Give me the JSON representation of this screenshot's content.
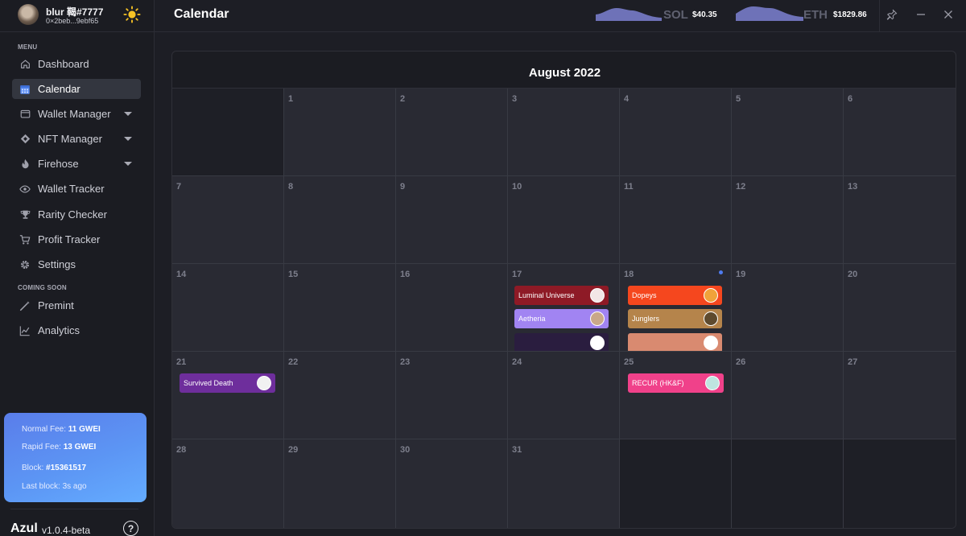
{
  "profile": {
    "username": "blur 鞨#7777",
    "address": "0×2beb...9ebf65"
  },
  "sidebar": {
    "menu_label": "MENU",
    "items": [
      {
        "label": "Dashboard",
        "icon": "home-icon"
      },
      {
        "label": "Calendar",
        "icon": "calendar-icon",
        "active": true
      },
      {
        "label": "Wallet Manager",
        "icon": "wallet-icon",
        "expandable": true
      },
      {
        "label": "NFT Manager",
        "icon": "diamond-icon",
        "expandable": true
      },
      {
        "label": "Firehose",
        "icon": "flame-icon",
        "expandable": true
      },
      {
        "label": "Wallet Tracker",
        "icon": "eye-icon"
      },
      {
        "label": "Rarity Checker",
        "icon": "trophy-icon"
      },
      {
        "label": "Profit Tracker",
        "icon": "cart-icon"
      },
      {
        "label": "Settings",
        "icon": "gear-icon"
      }
    ],
    "coming_soon_label": "COMING SOON",
    "coming_soon": [
      {
        "label": "Premint",
        "icon": "wand-icon"
      },
      {
        "label": "Analytics",
        "icon": "chart-icon"
      }
    ]
  },
  "fees": {
    "normal_label": "Normal Fee:",
    "normal_value": "11 GWEI",
    "rapid_label": "Rapid Fee:",
    "rapid_value": "13 GWEI",
    "block_label": "Block:",
    "block_value": "#15361517",
    "last_block_label": "Last block:",
    "last_block_value": "3s ago"
  },
  "brand": {
    "name": "Azul",
    "version": "v1.0.4-beta",
    "help": "?"
  },
  "topbar": {
    "title": "Calendar",
    "tickers": [
      {
        "symbol": "SOL",
        "price": "$40.35"
      },
      {
        "symbol": "ETH",
        "price": "$1829.86"
      }
    ]
  },
  "calendar": {
    "month": "August 2022",
    "weeks": [
      [
        "",
        "1",
        "2",
        "3",
        "4",
        "5",
        "6"
      ],
      [
        "7",
        "8",
        "9",
        "10",
        "11",
        "12",
        "13"
      ],
      [
        "14",
        "15",
        "16",
        "17",
        "18",
        "19",
        "20"
      ],
      [
        "21",
        "22",
        "23",
        "24",
        "25",
        "26",
        "27"
      ],
      [
        "28",
        "29",
        "30",
        "31",
        "",
        "",
        ""
      ]
    ],
    "events": [
      {
        "name": "Luminal Universe",
        "color": "#8e1a26",
        "logo_bg": "#f2e6e6"
      },
      {
        "name": "Aetheria",
        "color": "#a184f2",
        "logo_bg": "#c9a88a"
      },
      {
        "name": "",
        "color": "#2a1d3f",
        "logo_bg": "#ffffff"
      },
      {
        "name": "Dopeys",
        "color": "#f5471e",
        "logo_bg": "#f0a23a"
      },
      {
        "name": "Junglers",
        "color": "#b5844b",
        "logo_bg": "#5e4a2e"
      },
      {
        "name": "",
        "color": "#d98a70",
        "logo_bg": "#ffffff"
      },
      {
        "name": "Survived Death",
        "color": "#6e2e9c",
        "logo_bg": "#f1f1f1"
      },
      {
        "name": "RECUR (HK&F)",
        "color": "#f0418a",
        "logo_bg": "#bfe5e0"
      }
    ]
  },
  "colors": {
    "accent": "#4f7cf0",
    "card_gradient_start": "#5a7dea",
    "card_gradient_end": "#64acff"
  }
}
